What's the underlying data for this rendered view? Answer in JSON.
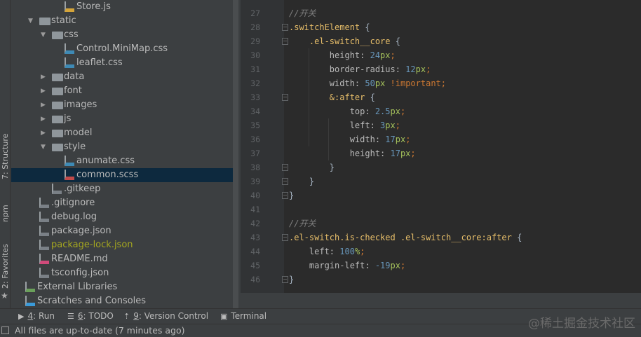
{
  "side_tabs": [
    "7: Structure",
    "npm",
    "2: Favorites"
  ],
  "tree": [
    {
      "name": "Store.js",
      "type": "js",
      "depth": 3
    },
    {
      "name": "static",
      "type": "folder",
      "open": true,
      "depth": 1
    },
    {
      "name": "css",
      "type": "folder",
      "open": true,
      "depth": 2
    },
    {
      "name": "Control.MiniMap.css",
      "type": "css",
      "depth": 3
    },
    {
      "name": "leaflet.css",
      "type": "css",
      "depth": 3
    },
    {
      "name": "data",
      "type": "folder",
      "open": false,
      "depth": 2
    },
    {
      "name": "font",
      "type": "folder",
      "open": false,
      "depth": 2
    },
    {
      "name": "images",
      "type": "folder",
      "open": false,
      "depth": 2
    },
    {
      "name": "js",
      "type": "folder",
      "open": false,
      "depth": 2
    },
    {
      "name": "model",
      "type": "folder",
      "open": false,
      "depth": 2
    },
    {
      "name": "style",
      "type": "folder",
      "open": true,
      "depth": 2
    },
    {
      "name": "anumate.css",
      "type": "css",
      "depth": 3
    },
    {
      "name": "common.scss",
      "type": "sass",
      "depth": 3,
      "selected": true
    },
    {
      "name": ".gitkeep",
      "type": "unknown",
      "depth": 2
    },
    {
      "name": ".gitignore",
      "type": "ignore",
      "depth": 1
    },
    {
      "name": "debug.log",
      "type": "unknown",
      "depth": 1
    },
    {
      "name": "package.json",
      "type": "json",
      "depth": 1
    },
    {
      "name": "package-lock.json",
      "type": "json",
      "depth": 1,
      "color": "#a4a620"
    },
    {
      "name": "README.md",
      "type": "md",
      "depth": 1
    },
    {
      "name": "tsconfig.json",
      "type": "json",
      "depth": 1
    },
    {
      "name": "External Libraries",
      "type": "libs",
      "depth": 0
    },
    {
      "name": "Scratches and Consoles",
      "type": "scratch",
      "depth": 0
    }
  ],
  "editor": {
    "first_line": 27,
    "lines": [
      [
        [
          "cmt",
          "//开关"
        ]
      ],
      [
        [
          "sel-s",
          ".switchElement "
        ],
        [
          "brace",
          "{"
        ]
      ],
      [
        [
          "sel-s",
          "    .el-switch__core "
        ],
        [
          "brace",
          "{"
        ]
      ],
      [
        [
          "prop",
          "        height: "
        ],
        [
          "num",
          "24"
        ],
        [
          "unit",
          "px"
        ],
        [
          "pun",
          ";"
        ]
      ],
      [
        [
          "prop",
          "        border-radius: "
        ],
        [
          "num",
          "12"
        ],
        [
          "unit",
          "px"
        ],
        [
          "pun",
          ";"
        ]
      ],
      [
        [
          "prop",
          "        width: "
        ],
        [
          "num",
          "50"
        ],
        [
          "unit",
          "px "
        ],
        [
          "imp",
          "!important;"
        ]
      ],
      [
        [
          "sel-s",
          "        &:after "
        ],
        [
          "brace",
          "{"
        ]
      ],
      [
        [
          "prop",
          "            top: "
        ],
        [
          "num",
          "2.5"
        ],
        [
          "unit",
          "px"
        ],
        [
          "pun",
          ";"
        ]
      ],
      [
        [
          "prop",
          "            left: "
        ],
        [
          "num",
          "3"
        ],
        [
          "unit",
          "px"
        ],
        [
          "pun",
          ";"
        ]
      ],
      [
        [
          "prop",
          "            width: "
        ],
        [
          "num",
          "17"
        ],
        [
          "unit",
          "px"
        ],
        [
          "pun",
          ";"
        ]
      ],
      [
        [
          "prop",
          "            height: "
        ],
        [
          "num",
          "17"
        ],
        [
          "unit",
          "px"
        ],
        [
          "pun",
          ";"
        ]
      ],
      [
        [
          "brace",
          "        }"
        ]
      ],
      [
        [
          "brace",
          "    }"
        ]
      ],
      [
        [
          "brace",
          "}"
        ]
      ],
      [],
      [
        [
          "cmt",
          "//开关"
        ]
      ],
      [
        [
          "sel-s",
          ".el-switch.is-checked .el-switch__core:after "
        ],
        [
          "brace",
          "{"
        ]
      ],
      [
        [
          "prop",
          "    left: "
        ],
        [
          "num",
          "100"
        ],
        [
          "unit",
          "%"
        ],
        [
          "pun",
          ";"
        ]
      ],
      [
        [
          "prop",
          "    margin-left: "
        ],
        [
          "num",
          "-19"
        ],
        [
          "unit",
          "px"
        ],
        [
          "pun",
          ";"
        ]
      ],
      [
        [
          "brace",
          "}"
        ]
      ]
    ]
  },
  "bottom_tabs": [
    {
      "key": "4",
      "label": ": Run",
      "icon": "run-icon"
    },
    {
      "key": "6",
      "label": ": TODO",
      "icon": "todo-icon"
    },
    {
      "key": "9",
      "label": ": Version Control",
      "icon": "vcs-icon"
    },
    {
      "key": "",
      "label": "Terminal",
      "icon": "terminal-icon"
    }
  ],
  "status": {
    "text": "All files are up-to-date (7 minutes ago)"
  },
  "watermark": "@稀土掘金技术社区"
}
